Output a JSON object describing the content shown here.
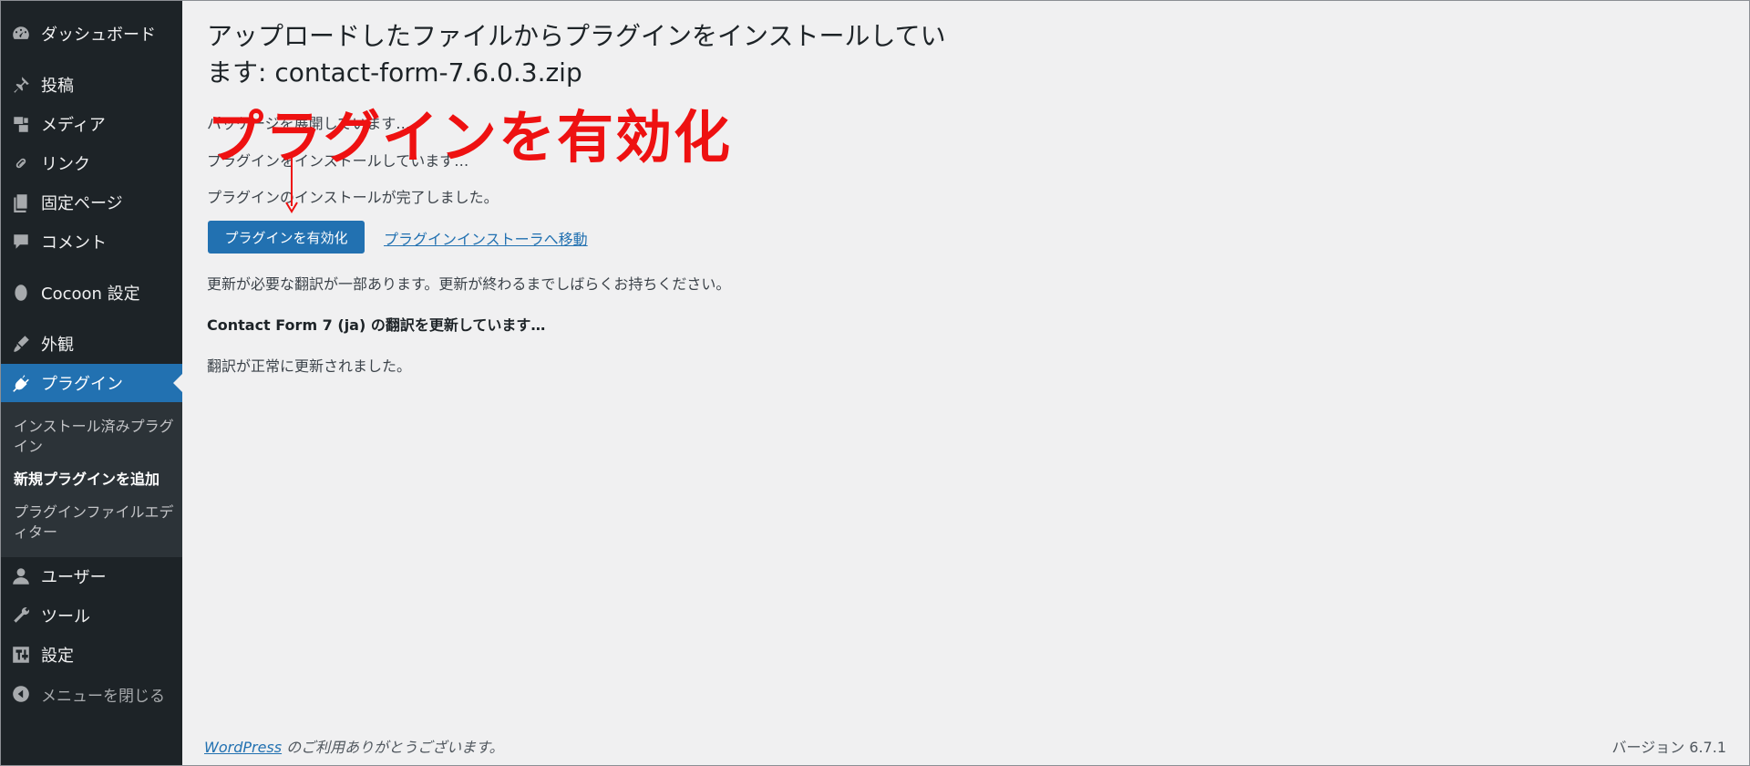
{
  "sidebar": {
    "items": [
      {
        "label": "ダッシュボード",
        "icon": "dashboard-icon"
      },
      {
        "label": "投稿",
        "icon": "pin-icon"
      },
      {
        "label": "メディア",
        "icon": "media-icon"
      },
      {
        "label": "リンク",
        "icon": "link-icon"
      },
      {
        "label": "固定ページ",
        "icon": "page-icon"
      },
      {
        "label": "コメント",
        "icon": "comment-icon"
      },
      {
        "label": "Cocoon 設定",
        "icon": "cocoon-icon"
      },
      {
        "label": "外観",
        "icon": "brush-icon"
      },
      {
        "label": "プラグイン",
        "icon": "plugin-icon"
      },
      {
        "label": "ユーザー",
        "icon": "user-icon"
      },
      {
        "label": "ツール",
        "icon": "wrench-icon"
      },
      {
        "label": "設定",
        "icon": "settings-icon"
      },
      {
        "label": "メニューを閉じる",
        "icon": "collapse-icon"
      }
    ],
    "submenu": [
      {
        "label": "インストール済みプラグイン"
      },
      {
        "label": "新規プラグインを追加"
      },
      {
        "label": "プラグインファイルエディター"
      }
    ]
  },
  "main": {
    "title": "アップロードしたファイルからプラグインをインストールしています: contact-form-7.6.0.3.zip",
    "messages": [
      "パッケージを展開しています…",
      "プラグインをインストールしています…",
      "プラグインのインストールが完了しました。"
    ],
    "activate_button": "プラグインを有効化",
    "installer_link": "プラグインインストーラへ移動",
    "translation_notice": "更新が必要な翻訳が一部あります。更新が終わるまでしばらくお持ちください。",
    "translation_updating": "Contact Form 7 (ja) の翻訳を更新しています…",
    "translation_done": "翻訳が正常に更新されました。"
  },
  "annotation": {
    "text": "プラグインを有効化",
    "color": "#ee1111"
  },
  "footer": {
    "wordpress_link": "WordPress",
    "thanks_rest": " のご利用ありがとうございます。",
    "version": "バージョン 6.7.1"
  },
  "colors": {
    "sidebar_bg": "#1d2327",
    "accent": "#2271b1",
    "page_bg": "#f0f0f1"
  }
}
